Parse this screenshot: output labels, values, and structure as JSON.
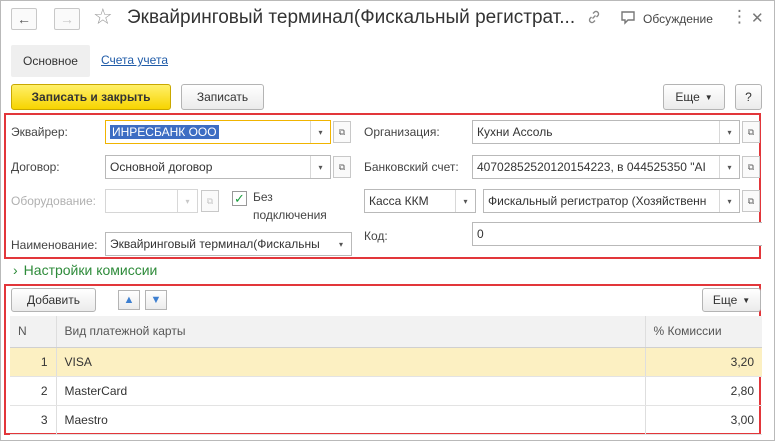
{
  "header": {
    "title": "Эквайринговый терминал(Фискальный регистрат...",
    "discussion_label": "Обсуждение",
    "back": "←",
    "forward": "→",
    "star": "☆",
    "link_glyph": "🔗",
    "chat_glyph": "🗨",
    "more_glyph": "⋮",
    "close_glyph": "✕"
  },
  "tabs": {
    "main": "Основное",
    "accounts": "Счета учета"
  },
  "toolbar": {
    "save_close": "Записать и закрыть",
    "save": "Записать",
    "more": "Еще",
    "help": "?"
  },
  "form": {
    "acquirer_label": "Эквайрер:",
    "acquirer_value": "ИНРЕСБАНК ООО",
    "contract_label": "Договор:",
    "contract_value": "Основной договор",
    "equipment_label": "Оборудование:",
    "equipment_value": "",
    "no_connection_line1": "Без",
    "no_connection_line2": "подключения",
    "no_connection_checked": true,
    "name_label": "Наименование:",
    "name_value": "Эквайринговый терминал(Фискальны",
    "org_label": "Организация:",
    "org_value": "Кухни Ассоль",
    "bank_label": "Банковский счет:",
    "bank_value": "40702852520120154223, в 044525350 \"АІ",
    "cash_type": "Касса ККМ",
    "cash_value": "Фискальный регистратор (Хозяйственн",
    "code_label": "Код:",
    "code_value": "0"
  },
  "commission": {
    "section_title": "Настройки комиссии",
    "chevron": "›",
    "add_button": "Добавить",
    "more": "Еще",
    "up_arrow": "▲",
    "down_arrow": "▼",
    "columns": {
      "n": "N",
      "card": "Вид платежной карты",
      "pct": "% Комиссии"
    },
    "rows": [
      {
        "n": "1",
        "card": "VISA",
        "pct": "3,20"
      },
      {
        "n": "2",
        "card": "MasterCard",
        "pct": "2,80"
      },
      {
        "n": "3",
        "card": "Maestro",
        "pct": "3,00"
      }
    ],
    "active_row": 0
  }
}
